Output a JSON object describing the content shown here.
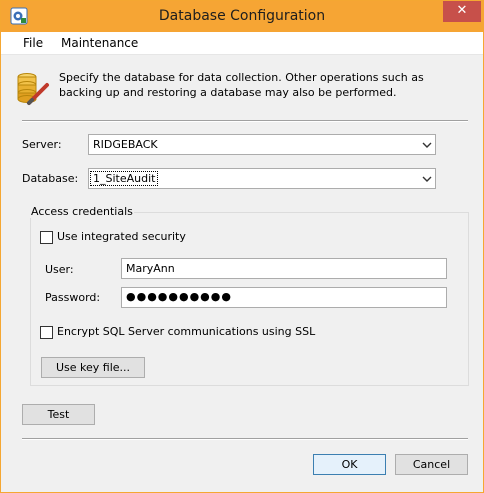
{
  "window": {
    "title": "Database Configuration",
    "close_glyph": "✕"
  },
  "menu": {
    "items": [
      "File",
      "Maintenance"
    ]
  },
  "header": {
    "description": "Specify the database for data collection. Other operations such as backing up and restoring a database may also be performed.",
    "icon": "database-edit-icon"
  },
  "form": {
    "server_label": "Server:",
    "server_value": "RIDGEBACK",
    "database_label": "Database:",
    "database_value": "1_SiteAudit"
  },
  "credentials": {
    "group_title": "Access credentials",
    "integrated_security_label": "Use integrated security",
    "integrated_security_checked": false,
    "user_label": "User:",
    "user_value": "MaryAnn",
    "password_label": "Password:",
    "password_masked": "●●●●●●●●●●",
    "ssl_label": "Encrypt SQL Server communications using SSL",
    "ssl_checked": false,
    "key_file_button": "Use key file..."
  },
  "buttons": {
    "test": "Test",
    "ok": "OK",
    "cancel": "Cancel"
  },
  "colors": {
    "titlebar": "#f6a534",
    "close": "#c7504a",
    "accent": "#3c7fb1"
  }
}
